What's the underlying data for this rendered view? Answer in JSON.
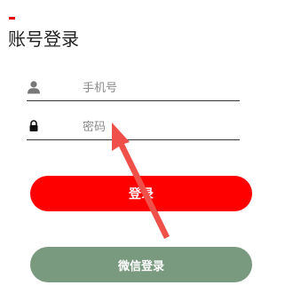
{
  "header": {
    "title": "账号登录",
    "accent_color": "#e60012"
  },
  "form": {
    "phone": {
      "icon": "user-icon",
      "placeholder": "手机号",
      "value": ""
    },
    "password": {
      "icon": "lock-icon",
      "placeholder": "密码",
      "value": ""
    },
    "login_label": "登录",
    "wechat_login_label": "微信登录"
  },
  "colors": {
    "primary": "#fe0000",
    "wechat": "#7a9a7f",
    "annotation_arrow": "#f0504a"
  }
}
